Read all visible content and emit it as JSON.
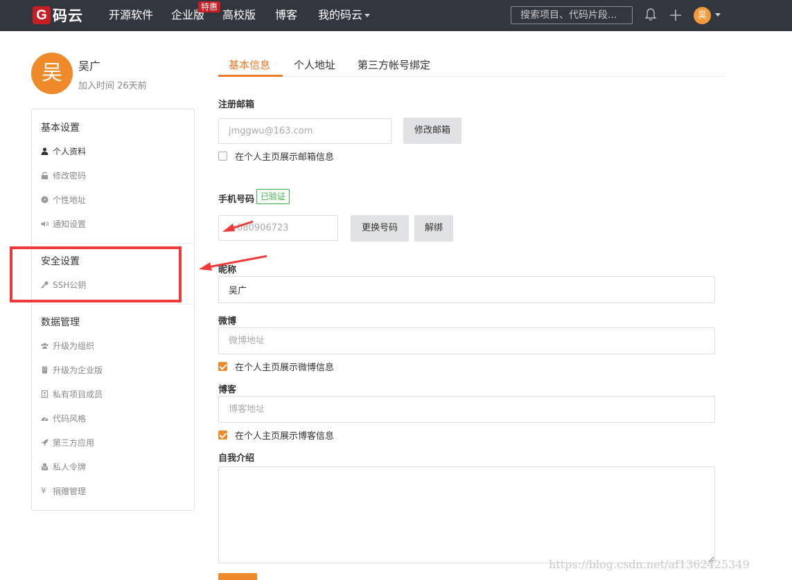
{
  "topbar": {
    "logo_mark": "G",
    "logo_text": "码云",
    "nav": [
      "开源软件",
      "企业版",
      "高校版",
      "博客",
      "我的码云"
    ],
    "badge": "特惠",
    "search_placeholder": "搜索项目、代码片段...",
    "avatar_text": "吴"
  },
  "profile": {
    "avatar_text": "吴",
    "name": "吴广",
    "joined": "加入时间 26天前"
  },
  "sidebar": {
    "basic_title": "基本设置",
    "basic_items": [
      "个人资料",
      "修改密码",
      "个性地址",
      "通知设置"
    ],
    "security_title": "安全设置",
    "security_items": [
      "SSH公钥"
    ],
    "data_title": "数据管理",
    "data_items": [
      "升级为组织",
      "升级为企业版",
      "私有项目成员",
      "代码风格",
      "第三方应用",
      "私人令牌",
      "捐赠管理"
    ]
  },
  "tabs": [
    "基本信息",
    "个人地址",
    "第三方帐号绑定"
  ],
  "form": {
    "email_label": "注册邮箱",
    "email_value": "jmggwu@163.com",
    "email_button": "修改邮箱",
    "email_check": "在个人主页展示邮箱信息",
    "phone_label": "手机号码",
    "phone_verified": "已验证",
    "phone_value": "080906723",
    "phone_change_button": "更换号码",
    "phone_unbind_button": "解绑",
    "nickname_label": "昵称",
    "nickname_value": "吴广",
    "weibo_label": "微博",
    "weibo_placeholder": "微博地址",
    "weibo_check": "在个人主页展示微博信息",
    "blog_label": "博客",
    "blog_placeholder": "博客地址",
    "blog_check": "在个人主页展示博客信息",
    "intro_label": "自我介绍"
  },
  "watermark": "https://blog.csdn.net/af1362425349",
  "colors": {
    "topbar_bg": "#32373f",
    "accent": "#ec7b26",
    "annotation_red": "#f03a3a",
    "verified_green": "#3aae4a"
  }
}
